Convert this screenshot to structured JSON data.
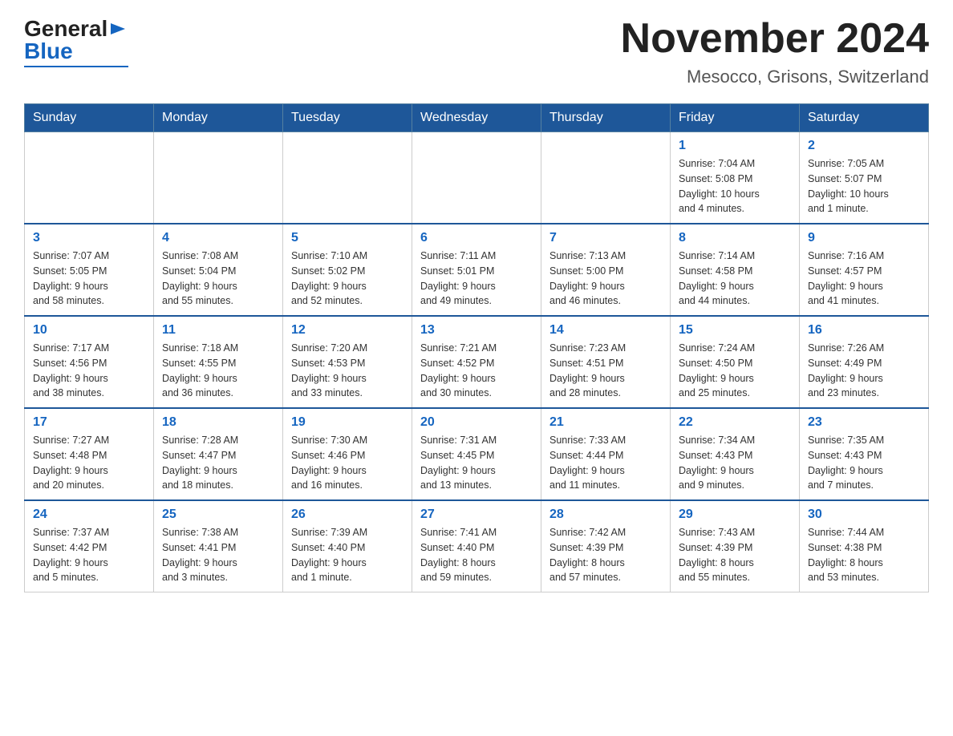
{
  "logo": {
    "general": "General",
    "blue": "Blue"
  },
  "title": "November 2024",
  "subtitle": "Mesocco, Grisons, Switzerland",
  "weekdays": [
    "Sunday",
    "Monday",
    "Tuesday",
    "Wednesday",
    "Thursday",
    "Friday",
    "Saturday"
  ],
  "weeks": [
    [
      {
        "day": "",
        "info": ""
      },
      {
        "day": "",
        "info": ""
      },
      {
        "day": "",
        "info": ""
      },
      {
        "day": "",
        "info": ""
      },
      {
        "day": "",
        "info": ""
      },
      {
        "day": "1",
        "info": "Sunrise: 7:04 AM\nSunset: 5:08 PM\nDaylight: 10 hours\nand 4 minutes."
      },
      {
        "day": "2",
        "info": "Sunrise: 7:05 AM\nSunset: 5:07 PM\nDaylight: 10 hours\nand 1 minute."
      }
    ],
    [
      {
        "day": "3",
        "info": "Sunrise: 7:07 AM\nSunset: 5:05 PM\nDaylight: 9 hours\nand 58 minutes."
      },
      {
        "day": "4",
        "info": "Sunrise: 7:08 AM\nSunset: 5:04 PM\nDaylight: 9 hours\nand 55 minutes."
      },
      {
        "day": "5",
        "info": "Sunrise: 7:10 AM\nSunset: 5:02 PM\nDaylight: 9 hours\nand 52 minutes."
      },
      {
        "day": "6",
        "info": "Sunrise: 7:11 AM\nSunset: 5:01 PM\nDaylight: 9 hours\nand 49 minutes."
      },
      {
        "day": "7",
        "info": "Sunrise: 7:13 AM\nSunset: 5:00 PM\nDaylight: 9 hours\nand 46 minutes."
      },
      {
        "day": "8",
        "info": "Sunrise: 7:14 AM\nSunset: 4:58 PM\nDaylight: 9 hours\nand 44 minutes."
      },
      {
        "day": "9",
        "info": "Sunrise: 7:16 AM\nSunset: 4:57 PM\nDaylight: 9 hours\nand 41 minutes."
      }
    ],
    [
      {
        "day": "10",
        "info": "Sunrise: 7:17 AM\nSunset: 4:56 PM\nDaylight: 9 hours\nand 38 minutes."
      },
      {
        "day": "11",
        "info": "Sunrise: 7:18 AM\nSunset: 4:55 PM\nDaylight: 9 hours\nand 36 minutes."
      },
      {
        "day": "12",
        "info": "Sunrise: 7:20 AM\nSunset: 4:53 PM\nDaylight: 9 hours\nand 33 minutes."
      },
      {
        "day": "13",
        "info": "Sunrise: 7:21 AM\nSunset: 4:52 PM\nDaylight: 9 hours\nand 30 minutes."
      },
      {
        "day": "14",
        "info": "Sunrise: 7:23 AM\nSunset: 4:51 PM\nDaylight: 9 hours\nand 28 minutes."
      },
      {
        "day": "15",
        "info": "Sunrise: 7:24 AM\nSunset: 4:50 PM\nDaylight: 9 hours\nand 25 minutes."
      },
      {
        "day": "16",
        "info": "Sunrise: 7:26 AM\nSunset: 4:49 PM\nDaylight: 9 hours\nand 23 minutes."
      }
    ],
    [
      {
        "day": "17",
        "info": "Sunrise: 7:27 AM\nSunset: 4:48 PM\nDaylight: 9 hours\nand 20 minutes."
      },
      {
        "day": "18",
        "info": "Sunrise: 7:28 AM\nSunset: 4:47 PM\nDaylight: 9 hours\nand 18 minutes."
      },
      {
        "day": "19",
        "info": "Sunrise: 7:30 AM\nSunset: 4:46 PM\nDaylight: 9 hours\nand 16 minutes."
      },
      {
        "day": "20",
        "info": "Sunrise: 7:31 AM\nSunset: 4:45 PM\nDaylight: 9 hours\nand 13 minutes."
      },
      {
        "day": "21",
        "info": "Sunrise: 7:33 AM\nSunset: 4:44 PM\nDaylight: 9 hours\nand 11 minutes."
      },
      {
        "day": "22",
        "info": "Sunrise: 7:34 AM\nSunset: 4:43 PM\nDaylight: 9 hours\nand 9 minutes."
      },
      {
        "day": "23",
        "info": "Sunrise: 7:35 AM\nSunset: 4:43 PM\nDaylight: 9 hours\nand 7 minutes."
      }
    ],
    [
      {
        "day": "24",
        "info": "Sunrise: 7:37 AM\nSunset: 4:42 PM\nDaylight: 9 hours\nand 5 minutes."
      },
      {
        "day": "25",
        "info": "Sunrise: 7:38 AM\nSunset: 4:41 PM\nDaylight: 9 hours\nand 3 minutes."
      },
      {
        "day": "26",
        "info": "Sunrise: 7:39 AM\nSunset: 4:40 PM\nDaylight: 9 hours\nand 1 minute."
      },
      {
        "day": "27",
        "info": "Sunrise: 7:41 AM\nSunset: 4:40 PM\nDaylight: 8 hours\nand 59 minutes."
      },
      {
        "day": "28",
        "info": "Sunrise: 7:42 AM\nSunset: 4:39 PM\nDaylight: 8 hours\nand 57 minutes."
      },
      {
        "day": "29",
        "info": "Sunrise: 7:43 AM\nSunset: 4:39 PM\nDaylight: 8 hours\nand 55 minutes."
      },
      {
        "day": "30",
        "info": "Sunrise: 7:44 AM\nSunset: 4:38 PM\nDaylight: 8 hours\nand 53 minutes."
      }
    ]
  ]
}
